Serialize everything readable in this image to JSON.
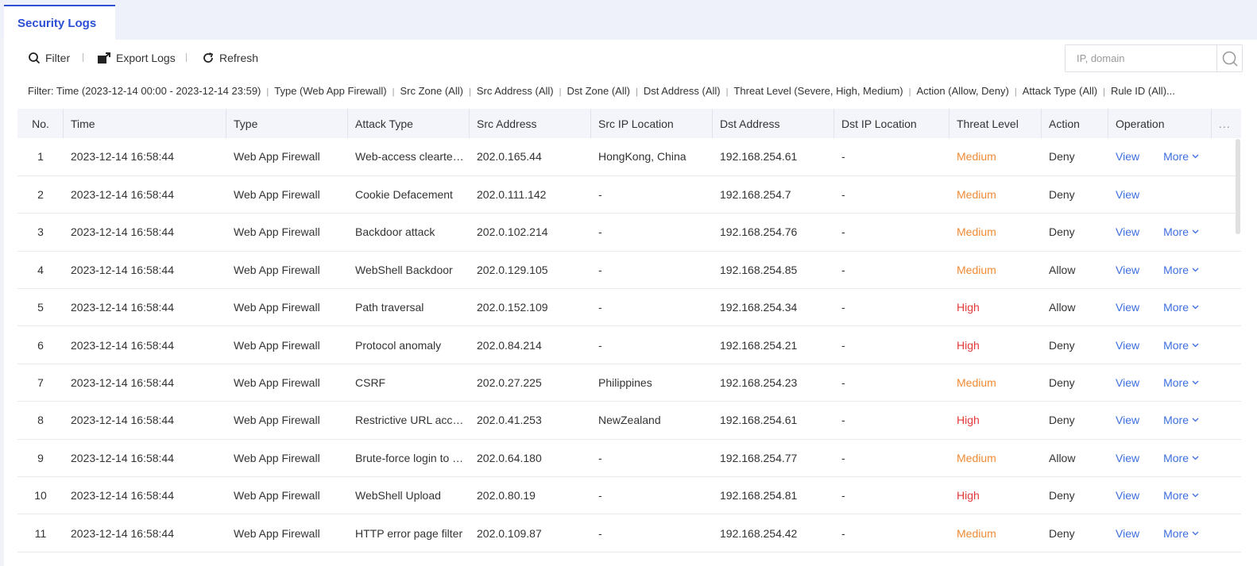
{
  "tab": {
    "label": "Security Logs"
  },
  "toolbar": {
    "filter_label": "Filter",
    "export_label": "Export Logs",
    "refresh_label": "Refresh"
  },
  "search": {
    "placeholder": "IP, domain",
    "value": ""
  },
  "filter_summary": [
    "Filter: Time (2023-12-14 00:00 - 2023-12-14 23:59)",
    "Type (Web App Firewall)",
    "Src Zone (All)",
    "Src Address (All)",
    "Dst Zone (All)",
    "Dst Address (All)",
    "Threat Level (Severe, High, Medium)",
    "Action (Allow, Deny)",
    "Attack Type (All)",
    "Rule ID (All)..."
  ],
  "columns": [
    "No.",
    "Time",
    "Type",
    "Attack Type",
    "Src Address",
    "Src IP Location",
    "Dst Address",
    "Dst IP Location",
    "Threat Level",
    "Action",
    "Operation",
    "..."
  ],
  "operation": {
    "view_label": "View",
    "more_label": "More"
  },
  "rows": [
    {
      "no": "1",
      "time": "2023-12-14 16:58:44",
      "type": "Web App Firewall",
      "attack": "Web-access clearte…",
      "src": "202.0.165.44",
      "src_loc": "HongKong, China",
      "dst": "192.168.254.61",
      "dst_loc": "-",
      "level": "Medium",
      "action": "Deny",
      "more": true
    },
    {
      "no": "2",
      "time": "2023-12-14 16:58:44",
      "type": "Web App Firewall",
      "attack": "Cookie Defacement",
      "src": "202.0.111.142",
      "src_loc": "-",
      "dst": "192.168.254.7",
      "dst_loc": "-",
      "level": "Medium",
      "action": "Deny",
      "more": false
    },
    {
      "no": "3",
      "time": "2023-12-14 16:58:44",
      "type": "Web App Firewall",
      "attack": "Backdoor attack",
      "src": "202.0.102.214",
      "src_loc": "-",
      "dst": "192.168.254.76",
      "dst_loc": "-",
      "level": "Medium",
      "action": "Deny",
      "more": true
    },
    {
      "no": "4",
      "time": "2023-12-14 16:58:44",
      "type": "Web App Firewall",
      "attack": "WebShell Backdoor",
      "src": "202.0.129.105",
      "src_loc": "-",
      "dst": "192.168.254.85",
      "dst_loc": "-",
      "level": "Medium",
      "action": "Allow",
      "more": true
    },
    {
      "no": "5",
      "time": "2023-12-14 16:58:44",
      "type": "Web App Firewall",
      "attack": "Path traversal",
      "src": "202.0.152.109",
      "src_loc": "-",
      "dst": "192.168.254.34",
      "dst_loc": "-",
      "level": "High",
      "action": "Allow",
      "more": true
    },
    {
      "no": "6",
      "time": "2023-12-14 16:58:44",
      "type": "Web App Firewall",
      "attack": "Protocol anomaly",
      "src": "202.0.84.214",
      "src_loc": "-",
      "dst": "192.168.254.21",
      "dst_loc": "-",
      "level": "High",
      "action": "Deny",
      "more": true
    },
    {
      "no": "7",
      "time": "2023-12-14 16:58:44",
      "type": "Web App Firewall",
      "attack": "CSRF",
      "src": "202.0.27.225",
      "src_loc": "Philippines",
      "dst": "192.168.254.23",
      "dst_loc": "-",
      "level": "Medium",
      "action": "Deny",
      "more": true
    },
    {
      "no": "8",
      "time": "2023-12-14 16:58:44",
      "type": "Web App Firewall",
      "attack": "Restrictive URL acc…",
      "src": "202.0.41.253",
      "src_loc": "NewZealand",
      "dst": "192.168.254.61",
      "dst_loc": "-",
      "level": "High",
      "action": "Deny",
      "more": true
    },
    {
      "no": "9",
      "time": "2023-12-14 16:58:44",
      "type": "Web App Firewall",
      "attack": "Brute-force login to …",
      "src": "202.0.64.180",
      "src_loc": "-",
      "dst": "192.168.254.77",
      "dst_loc": "-",
      "level": "Medium",
      "action": "Allow",
      "more": true
    },
    {
      "no": "10",
      "time": "2023-12-14 16:58:44",
      "type": "Web App Firewall",
      "attack": "WebShell Upload",
      "src": "202.0.80.19",
      "src_loc": "-",
      "dst": "192.168.254.81",
      "dst_loc": "-",
      "level": "High",
      "action": "Deny",
      "more": true
    },
    {
      "no": "11",
      "time": "2023-12-14 16:58:44",
      "type": "Web App Firewall",
      "attack": "HTTP error page filter",
      "src": "202.0.109.87",
      "src_loc": "-",
      "dst": "192.168.254.42",
      "dst_loc": "-",
      "level": "Medium",
      "action": "Deny",
      "more": true
    }
  ],
  "colors": {
    "accent": "#2d4fd6",
    "link": "#3d6fe0",
    "medium": "#f08a34",
    "high": "#e23a3a"
  }
}
